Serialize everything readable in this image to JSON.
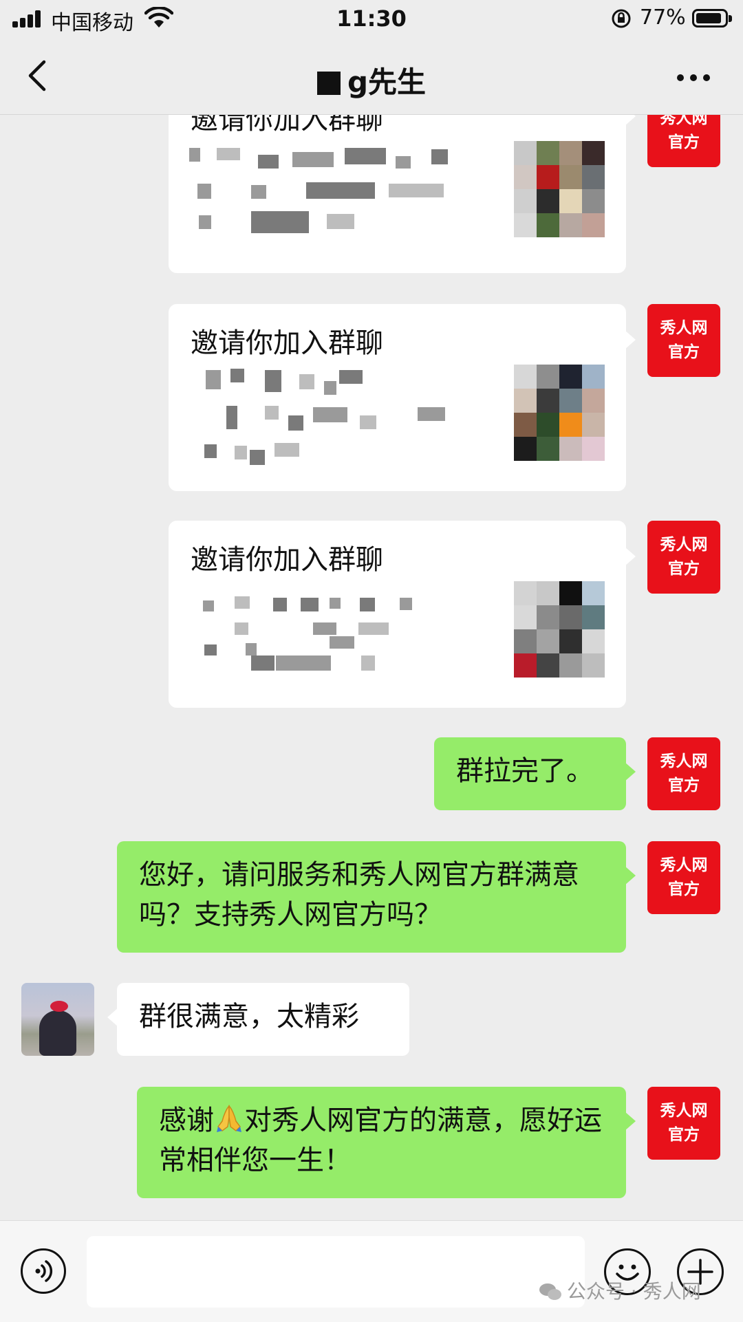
{
  "status_bar": {
    "carrier": "中国移动",
    "time": "11:30",
    "battery_percent": "77%",
    "battery_level": 0.77,
    "icons": [
      "signal-icon",
      "wifi-icon",
      "rotation-lock-icon",
      "battery-icon"
    ]
  },
  "nav": {
    "title_visible": "g先生",
    "icons": [
      "back-arrow-icon",
      "more-icon"
    ]
  },
  "contacts": {
    "self_avatar_line1": "秀人网",
    "self_avatar_line2": "官方"
  },
  "messages": [
    {
      "type": "invite-card",
      "sender": "self",
      "title": "邀请你加入群聊",
      "visible_fragments": [
        "\"秀",
        "时，",
        "进"
      ]
    },
    {
      "type": "invite-card",
      "sender": "self",
      "title": "邀请你加入群聊",
      "visible_fragments": [
        "\"秀",
        "，",
        "查看详情。"
      ]
    },
    {
      "type": "invite-card",
      "sender": "self",
      "title": "邀请你加入群聊",
      "visible_fragments": [
        "邀请你"
      ]
    },
    {
      "type": "text",
      "sender": "self",
      "text": "群拉完了。"
    },
    {
      "type": "text",
      "sender": "self",
      "text": "您好，请问服务和秀人网官方群满意吗？支持秀人网官方吗？"
    },
    {
      "type": "text",
      "sender": "other",
      "text": "群很满意，太精彩"
    },
    {
      "type": "text",
      "sender": "self",
      "text_before_emoji": "感谢",
      "emoji": "folded-hands",
      "text_after_emoji": "对秀人网官方的满意，愿好运常相伴您一生！"
    }
  ],
  "input_bar": {
    "value": "",
    "icons": [
      "voice-icon",
      "emoji-icon",
      "plus-icon"
    ]
  },
  "watermark": "公众号 · 秀人网",
  "colors": {
    "background": "#ededed",
    "self_bubble": "#95ec69",
    "other_bubble": "#ffffff",
    "avatar_red": "#e8111a"
  }
}
